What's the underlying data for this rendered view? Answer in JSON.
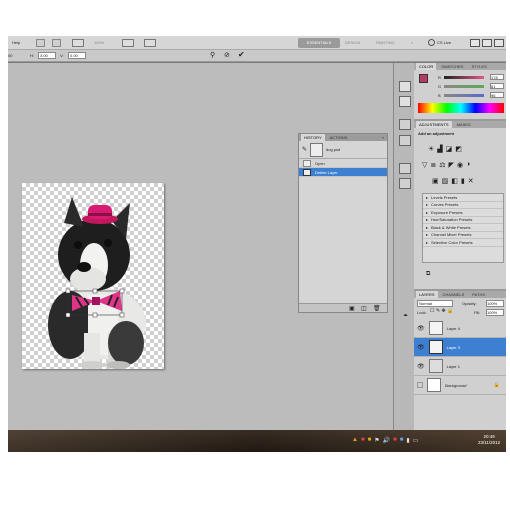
{
  "menubar": {
    "app_menu": "Help",
    "zoom": "100%",
    "workspaces": [
      "ESSENTIALS",
      "DESIGN",
      "PAINTING"
    ],
    "more": "»",
    "cslive": "CS Live"
  },
  "options": {
    "h_value": "3.00",
    "v_value": "0.00",
    "x_label": "H:",
    "v_label": "V:",
    "field_prefix": "00"
  },
  "history": {
    "tabs": [
      "HISTORY",
      "ACTIONS"
    ],
    "snapshot_label": "dog.psd",
    "items": [
      "Open",
      "Delete Layer"
    ]
  },
  "color_panel": {
    "tabs": [
      "COLOR",
      "SWATCHES",
      "STYLES"
    ],
    "r_value": "178",
    "g_value": "61",
    "b_value": "96",
    "r_label": "R",
    "g_label": "G",
    "b_label": "B",
    "colors": {
      "foreground": "#b23d60",
      "r_track": "#e05a8a",
      "g_track": "#5ea85a",
      "b_track": "#5a6ad0"
    }
  },
  "adjustments": {
    "tabs": [
      "ADJUSTMENTS",
      "MASKS"
    ],
    "heading": "Add an adjustment",
    "presets": [
      "Levels Presets",
      "Curves Presets",
      "Exposure Presets",
      "Hue/Saturation Presets",
      "Black & White Presets",
      "Channel Mixer Presets",
      "Selective Color Presets"
    ]
  },
  "layers": {
    "tabs": [
      "LAYERS",
      "CHANNELS",
      "PATHS"
    ],
    "blend_mode": "Normal",
    "opacity_label": "Opacity:",
    "opacity": "100%",
    "lock_label": "Lock:",
    "fill_label": "Fill:",
    "fill": "100%",
    "items": [
      {
        "name": "Layer 4",
        "selected": false
      },
      {
        "name": "Layer 3",
        "selected": true
      },
      {
        "name": "Layer 1",
        "selected": false
      },
      {
        "name": "Background",
        "selected": false
      }
    ]
  },
  "taskbar": {
    "time": "20:49",
    "date": "23/11/2012"
  }
}
